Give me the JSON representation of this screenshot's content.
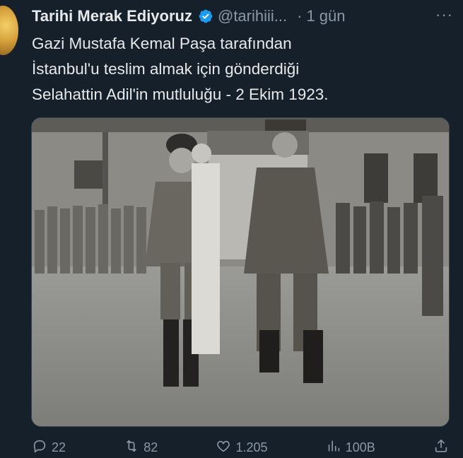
{
  "tweet": {
    "author_name": "Tarihi Merak Ediyoruz",
    "handle": "@tarihiii...",
    "separator": "·",
    "time": "1 gün",
    "more": "···",
    "text_lines": [
      "Gazi Mustafa Kemal Paşa tarafından",
      "İstanbul'u teslim almak için gönderdiği",
      "Selahattin Adil'in mutluluğu - 2 Ekim 1923."
    ]
  },
  "icons": {
    "verified": "verified-badge-icon",
    "reply": "reply-icon",
    "retweet": "retweet-icon",
    "like": "heart-icon",
    "views": "views-icon",
    "share": "share-icon"
  },
  "actions": {
    "replies": "22",
    "retweets": "82",
    "likes": "1.205",
    "views": "100B"
  },
  "colors": {
    "background": "#15202b",
    "verified_blue": "#1d9bf0",
    "secondary_text": "#8b98a5"
  }
}
